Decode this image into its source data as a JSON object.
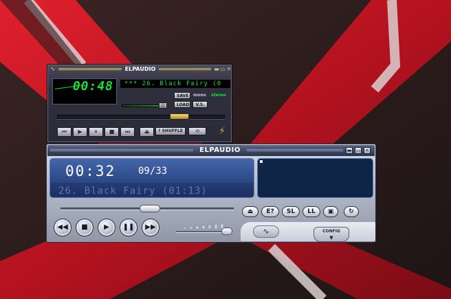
{
  "colors": {
    "background_dark": "#2a1d1d",
    "accent_red": "#c8162a",
    "lcd_green": "#16e03a",
    "display_blue": "#2a4684"
  },
  "player_classic": {
    "title": "ELPAUDIO",
    "time": "00:48",
    "song_marquee": "*** 26. Black Fairy (0",
    "save_label": "SAVE",
    "load_label": "LOAD",
    "vs_label": "V.S.",
    "mono_label": "mono",
    "stereo_label": "stereo",
    "shuffle_label": "SHUFFLE",
    "volume_fraction": 0.85,
    "seek_fraction": 0.73,
    "icons": [
      "menu-icon",
      "minimize-icon",
      "shade-icon",
      "close-icon",
      "prev-icon",
      "play-icon",
      "pause-icon",
      "stop-icon",
      "next-icon",
      "eject-icon",
      "repeat-icon",
      "logo-icon"
    ]
  },
  "player_modern": {
    "title": "ELPAUDIO",
    "time": "00:32",
    "track_counter": "09/33",
    "song": "26. Black Fairy (01:13)",
    "buttons": {
      "eject": "⏏",
      "info": "E?",
      "sl": "SL",
      "ll": "LL",
      "repeat": "↻"
    },
    "config_label": "CONFIG",
    "seek_fraction": 0.55,
    "volume_fraction": 0.95,
    "icons": [
      "minimize-icon",
      "restore-icon",
      "close-icon",
      "rewind-icon",
      "stop-icon",
      "play-icon",
      "pause-icon",
      "fast-forward-icon",
      "equalizer-icon",
      "chevron-down-icon"
    ]
  }
}
